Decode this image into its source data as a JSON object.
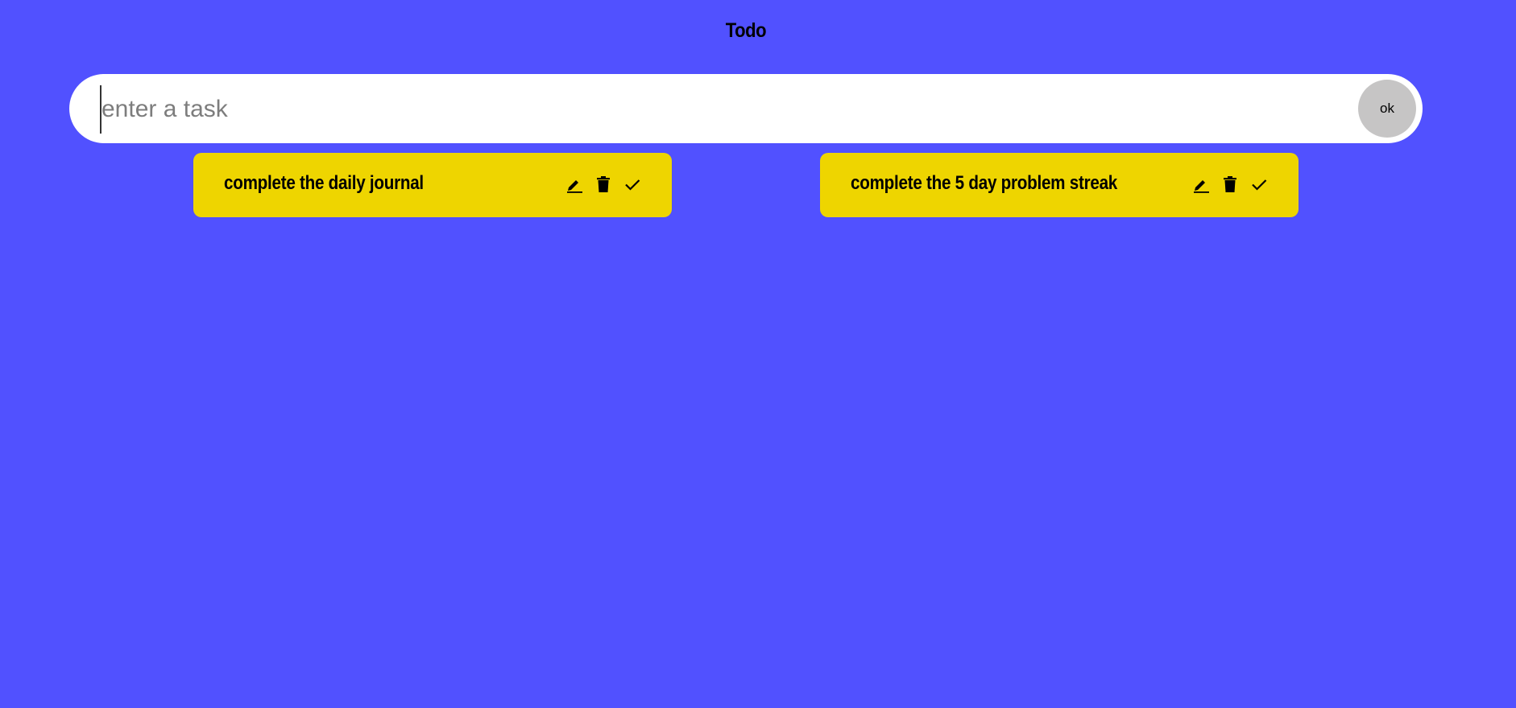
{
  "app": {
    "title": "Todo"
  },
  "input": {
    "placeholder": "enter a task",
    "value": "",
    "submit_label": "ok"
  },
  "tasks": [
    {
      "text": "complete the daily journal",
      "actions": [
        "edit-icon",
        "trash-icon",
        "check-icon"
      ]
    },
    {
      "text": "complete the 5 day problem streak",
      "actions": [
        "edit-icon",
        "trash-icon",
        "check-icon"
      ]
    }
  ],
  "colors": {
    "background": "#5151ff",
    "card": "#eed500",
    "input_bg": "#ffffff",
    "ok_button": "#c6c5c5",
    "text": "#000000"
  }
}
